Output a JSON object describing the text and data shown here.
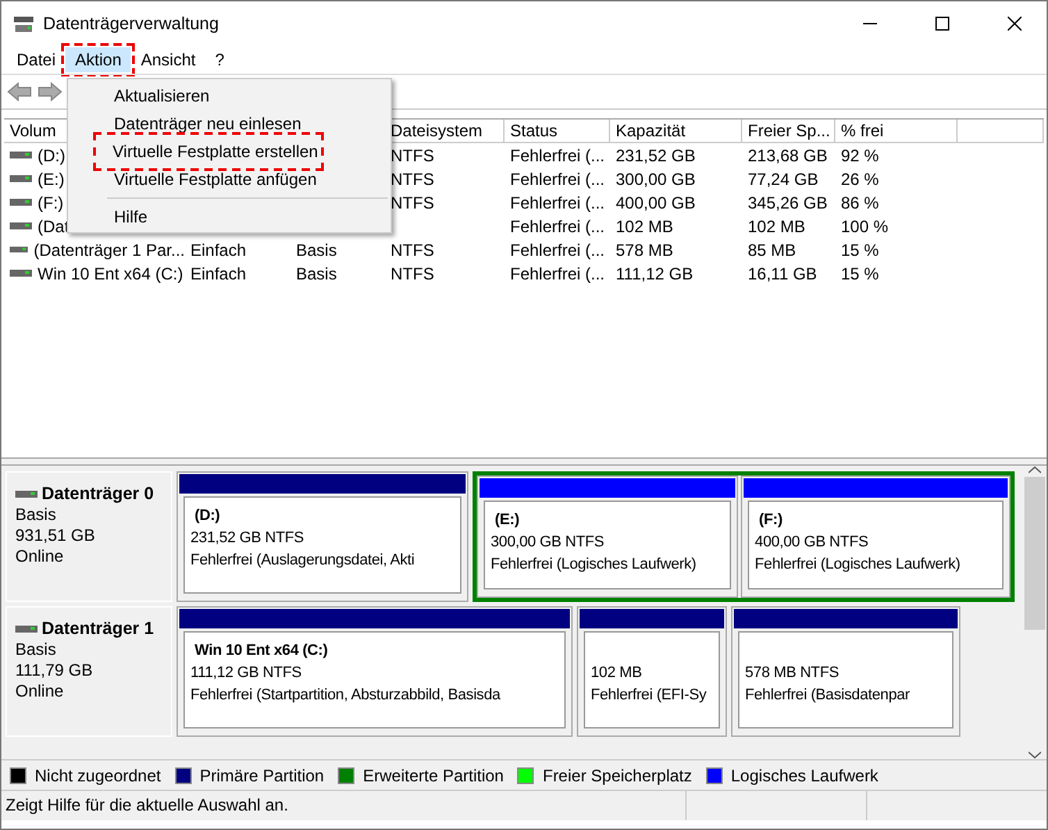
{
  "window": {
    "title": "Datenträgerverwaltung"
  },
  "menu": [
    {
      "label": "Datei",
      "selected": false,
      "highlighted": false
    },
    {
      "label": "Aktion",
      "selected": true,
      "highlighted": true
    },
    {
      "label": "Ansicht",
      "selected": false,
      "highlighted": false
    },
    {
      "label": "?",
      "selected": false,
      "highlighted": false
    }
  ],
  "dropdown": [
    {
      "label": "Aktualisieren",
      "highlighted": false,
      "separator_before": false
    },
    {
      "label": "Datenträger neu einlesen",
      "highlighted": false,
      "separator_before": false
    },
    {
      "label": "Virtuelle Festplatte erstellen",
      "highlighted": true,
      "separator_before": false
    },
    {
      "label": "Virtuelle Festplatte anfügen",
      "highlighted": false,
      "separator_before": false
    },
    {
      "label": "Hilfe",
      "highlighted": false,
      "separator_before": true
    }
  ],
  "table": {
    "columns": [
      "Volum",
      "",
      "",
      "Dateisystem",
      "Status",
      "Kapazität",
      "Freier Sp...",
      "% frei"
    ],
    "rows": [
      [
        "(D:)",
        "",
        "",
        "NTFS",
        "Fehlerfrei (...",
        "231,52 GB",
        "213,68 GB",
        "92 %"
      ],
      [
        "(E:)",
        "",
        "",
        "NTFS",
        "Fehlerfrei (...",
        "300,00 GB",
        "77,24 GB",
        "26 %"
      ],
      [
        "(F:)",
        "",
        "",
        "NTFS",
        "Fehlerfrei (...",
        "400,00 GB",
        "345,26 GB",
        "86 %"
      ],
      [
        "(Dat",
        "",
        "",
        "",
        "Fehlerfrei (...",
        "102 MB",
        "102 MB",
        "100 %"
      ],
      [
        "(Datenträger 1 Par...",
        "Einfach",
        "Basis",
        "NTFS",
        "Fehlerfrei (...",
        "578 MB",
        "85 MB",
        "15 %"
      ],
      [
        "Win 10 Ent x64 (C:)",
        "Einfach",
        "Basis",
        "NTFS",
        "Fehlerfrei (...",
        "111,12 GB",
        "16,11 GB",
        "15 %"
      ]
    ]
  },
  "disks": [
    {
      "name": "Datenträger 0",
      "type": "Basis",
      "size": "931,51 GB",
      "state": "Online",
      "partitions": [
        {
          "kind": "primary",
          "title": "(D:)",
          "size": "231,52 GB NTFS",
          "status": "Fehlerfrei (Auslagerungsdatei, Akti"
        },
        {
          "kind": "extended",
          "children": [
            {
              "kind": "logical",
              "title": "(E:)",
              "size": "300,00 GB NTFS",
              "status": "Fehlerfrei (Logisches Laufwerk)"
            },
            {
              "kind": "logical",
              "title": "(F:)",
              "size": "400,00 GB NTFS",
              "status": "Fehlerfrei (Logisches Laufwerk)"
            }
          ]
        }
      ]
    },
    {
      "name": "Datenträger 1",
      "type": "Basis",
      "size": "111,79 GB",
      "state": "Online",
      "partitions": [
        {
          "kind": "primary",
          "title": "Win 10 Ent x64  (C:)",
          "size": "111,12 GB NTFS",
          "status": "Fehlerfrei (Startpartition, Absturzabbild, Basisda"
        },
        {
          "kind": "primary",
          "size": "102 MB",
          "status": "Fehlerfrei (EFI-Sy"
        },
        {
          "kind": "primary",
          "size": "578 MB NTFS",
          "status": "Fehlerfrei (Basisdatenpar"
        }
      ]
    }
  ],
  "legend": [
    {
      "label": "Nicht zugeordnet",
      "color": "#000000"
    },
    {
      "label": "Primäre Partition",
      "color": "#000080"
    },
    {
      "label": "Erweiterte Partition",
      "color": "#008000"
    },
    {
      "label": "Freier Speicherplatz",
      "color": "#00ff00"
    },
    {
      "label": "Logisches Laufwerk",
      "color": "#0000ff"
    }
  ],
  "status_bar": {
    "text": "Zeigt Hilfe für die aktuelle Auswahl an."
  }
}
